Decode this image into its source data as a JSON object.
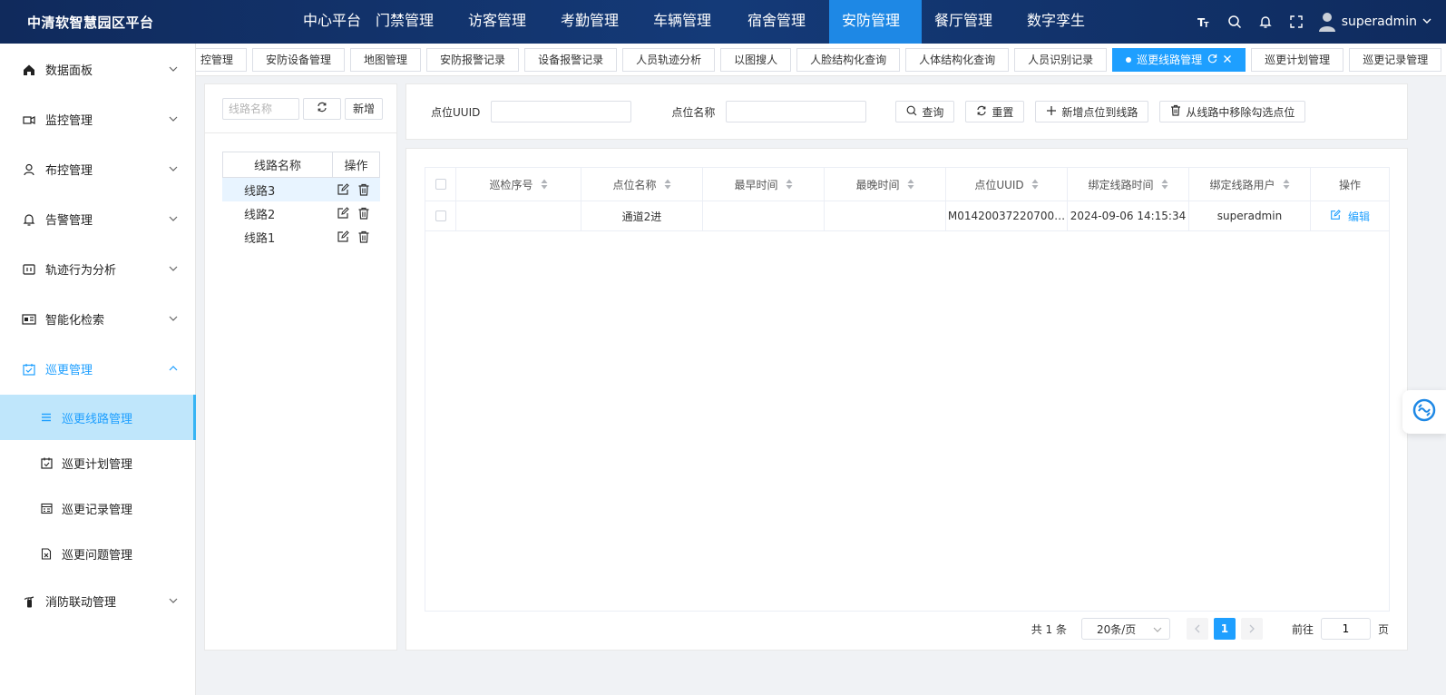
{
  "app": {
    "title": "中清软智慧园区平台"
  },
  "topnav": {
    "items": [
      "中心平台",
      "门禁管理",
      "访客管理",
      "考勤管理",
      "车辆管理",
      "宿舍管理",
      "安防管理",
      "餐厅管理",
      "数字孪生"
    ],
    "active": "安防管理"
  },
  "user": {
    "name": "superadmin"
  },
  "sidebar": {
    "items": [
      {
        "label": "数据面板",
        "icon": "home-icon"
      },
      {
        "label": "监控管理",
        "icon": "camera-icon"
      },
      {
        "label": "布控管理",
        "icon": "person-icon"
      },
      {
        "label": "告警管理",
        "icon": "bell-icon"
      },
      {
        "label": "轨迹行为分析",
        "icon": "track-icon"
      },
      {
        "label": "智能化检索",
        "icon": "id-card-icon"
      },
      {
        "label": "巡更管理",
        "icon": "calendar-check-icon"
      },
      {
        "label": "消防联动管理",
        "icon": "extinguisher-icon"
      }
    ],
    "sub_items": [
      {
        "label": "巡更线路管理",
        "icon": "list-icon"
      },
      {
        "label": "巡更计划管理",
        "icon": "calendar-icon"
      },
      {
        "label": "巡更记录管理",
        "icon": "grid-icon"
      },
      {
        "label": "巡更问题管理",
        "icon": "doc-x-icon"
      }
    ]
  },
  "tabs": {
    "items": [
      "控管理",
      "安防设备管理",
      "地图管理",
      "安防报警记录",
      "设备报警记录",
      "人员轨迹分析",
      "以图搜人",
      "人脸结构化查询",
      "人体结构化查询",
      "人员识别记录",
      "巡更线路管理",
      "巡更计划管理",
      "巡更记录管理"
    ],
    "active": "巡更线路管理"
  },
  "route_panel": {
    "search_placeholder": "线路名称",
    "add_label": "新增",
    "col_name": "线路名称",
    "col_ops": "操作",
    "routes": [
      "线路3",
      "线路2",
      "线路1"
    ]
  },
  "search": {
    "uuid_label": "点位UUID",
    "name_label": "点位名称",
    "query_label": "查询",
    "reset_label": "重置",
    "add_point_label": "新增点位到线路",
    "remove_label": "从线路中移除勾选点位"
  },
  "table": {
    "columns": [
      "巡检序号",
      "点位名称",
      "最早时间",
      "最晚时间",
      "点位UUID",
      "绑定线路时间",
      "绑定线路用户",
      "操作"
    ],
    "rows": [
      {
        "seq": "",
        "name": "通道2进",
        "earliest": "",
        "latest": "",
        "uuid": "M01420037220700…",
        "bind_time": "2024-09-06 14:15:34",
        "bind_user": "superadmin",
        "action": "编辑"
      }
    ]
  },
  "pager": {
    "total": "共 1 条",
    "page_size": "20条/页",
    "current": "1",
    "goto_label": "前往",
    "goto_value": "1",
    "page_suffix": "页"
  }
}
